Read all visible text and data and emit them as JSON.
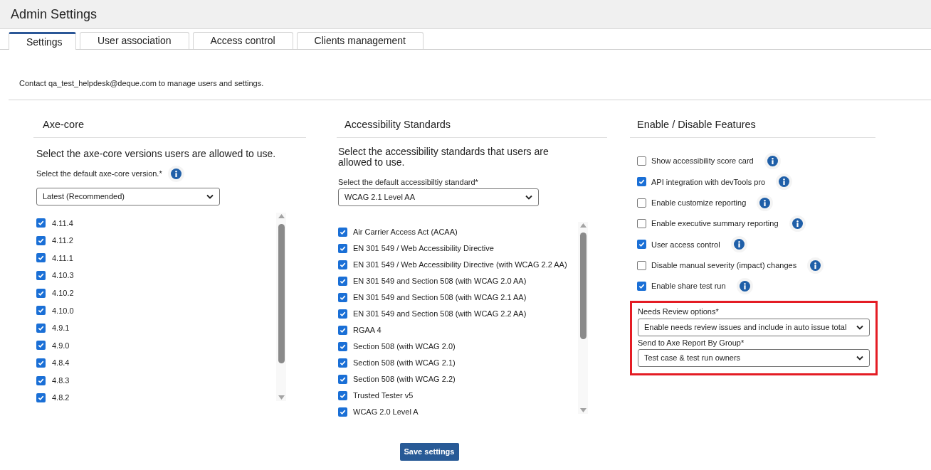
{
  "page_title": "Admin Settings",
  "tabs": [
    {
      "label": "Settings",
      "selected": true
    },
    {
      "label": "User association",
      "selected": false
    },
    {
      "label": "Access control",
      "selected": false
    },
    {
      "label": "Clients management",
      "selected": false
    }
  ],
  "contact_note": "Contact qa_test_helpdesk@deque.com to manage users and settings.",
  "axe_core": {
    "heading": "Axe-core",
    "description": "Select the axe-core versions users are allowed to use.",
    "default_label": "Select the default axe-core version.*",
    "default_value": "Latest (Recommended)",
    "versions": [
      {
        "label": "4.11.4",
        "checked": true
      },
      {
        "label": "4.11.2",
        "checked": true
      },
      {
        "label": "4.11.1",
        "checked": true
      },
      {
        "label": "4.10.3",
        "checked": true
      },
      {
        "label": "4.10.2",
        "checked": true
      },
      {
        "label": "4.10.0",
        "checked": true
      },
      {
        "label": "4.9.1",
        "checked": true
      },
      {
        "label": "4.9.0",
        "checked": true
      },
      {
        "label": "4.8.4",
        "checked": true
      },
      {
        "label": "4.8.3",
        "checked": true
      },
      {
        "label": "4.8.2",
        "checked": true
      }
    ]
  },
  "standards": {
    "heading": "Accessibility Standards",
    "description": "Select the accessibility standards that users are allowed to use.",
    "default_label": "Select the default accessibiltiy standard*",
    "default_value": "WCAG 2.1 Level AA",
    "items": [
      {
        "label": "Air Carrier Access Act (ACAA)",
        "checked": true
      },
      {
        "label": "EN 301 549 / Web Accessibility Directive",
        "checked": true
      },
      {
        "label": "EN 301 549 / Web Accessibility Directive (with WCAG 2.2 AA)",
        "checked": true
      },
      {
        "label": "EN 301 549 and Section 508 (with WCAG 2.0 AA)",
        "checked": true
      },
      {
        "label": "EN 301 549 and Section 508 (with WCAG 2.1 AA)",
        "checked": true
      },
      {
        "label": "EN 301 549 and Section 508 (with WCAG 2.2 AA)",
        "checked": true
      },
      {
        "label": "RGAA 4",
        "checked": true
      },
      {
        "label": "Section 508 (with WCAG 2.0)",
        "checked": true
      },
      {
        "label": "Section 508 (with WCAG 2.1)",
        "checked": true
      },
      {
        "label": "Section 508 (with WCAG 2.2)",
        "checked": true
      },
      {
        "label": "Trusted Tester v5",
        "checked": true
      },
      {
        "label": "WCAG 2.0 Level A",
        "checked": true
      }
    ]
  },
  "features": {
    "heading": "Enable / Disable Features",
    "items": [
      {
        "label": "Show accessibility score card",
        "checked": false
      },
      {
        "label": "API integration with devTools pro",
        "checked": true
      },
      {
        "label": "Enable customize reporting",
        "checked": false
      },
      {
        "label": "Enable executive summary reporting",
        "checked": false
      },
      {
        "label": "User access control",
        "checked": true
      },
      {
        "label": "Disable manual severity (impact) changes",
        "checked": false
      },
      {
        "label": "Enable share test run",
        "checked": true
      }
    ],
    "selects": [
      {
        "label": "Needs Review options*",
        "value": "Enable needs review issues and include in auto issue total"
      },
      {
        "label": "Send to Axe Report By Group*",
        "value": "Test case & test run owners"
      }
    ]
  },
  "save_button": "Save settings"
}
